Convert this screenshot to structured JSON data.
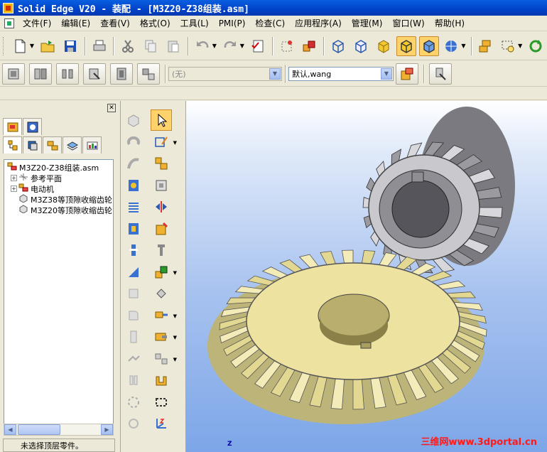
{
  "window": {
    "title": "Solid Edge V20 - 装配 - [M3Z20-Z38组装.asm]"
  },
  "menu": [
    "文件(F)",
    "编辑(E)",
    "查看(V)",
    "格式(O)",
    "工具(L)",
    "PMI(P)",
    "检查(C)",
    "应用程序(A)",
    "管理(M)",
    "窗口(W)",
    "帮助(H)"
  ],
  "toolbar2": {
    "layer_combo": "(无)",
    "user_combo": "默认,wang"
  },
  "tree": {
    "nodes": [
      {
        "label": "M3Z20-Z38组装.asm",
        "expander": "−",
        "icon": "assembly-icon"
      },
      {
        "label": "参考平面",
        "expander": "+",
        "icon": "reference-plane-icon"
      },
      {
        "label": "电动机",
        "expander": "+",
        "icon": "subassembly-icon"
      },
      {
        "label": "M3Z38等顶隙收缩齿轮",
        "expander": "",
        "icon": "part-icon"
      },
      {
        "label": "M3Z20等顶隙收缩齿轮",
        "expander": "",
        "icon": "part-icon"
      }
    ]
  },
  "status": {
    "text": "未选择顶层零件。"
  },
  "viewport": {
    "watermark": "三维网www.3dportal.cn",
    "axis_label": "Z"
  },
  "colors": {
    "titlebar": "#0042c8",
    "big_gear": "#ede2a0",
    "small_gear": "#b9b9be",
    "viewport_bg": "#8fb2ea",
    "active_button": "#ffd26b"
  }
}
